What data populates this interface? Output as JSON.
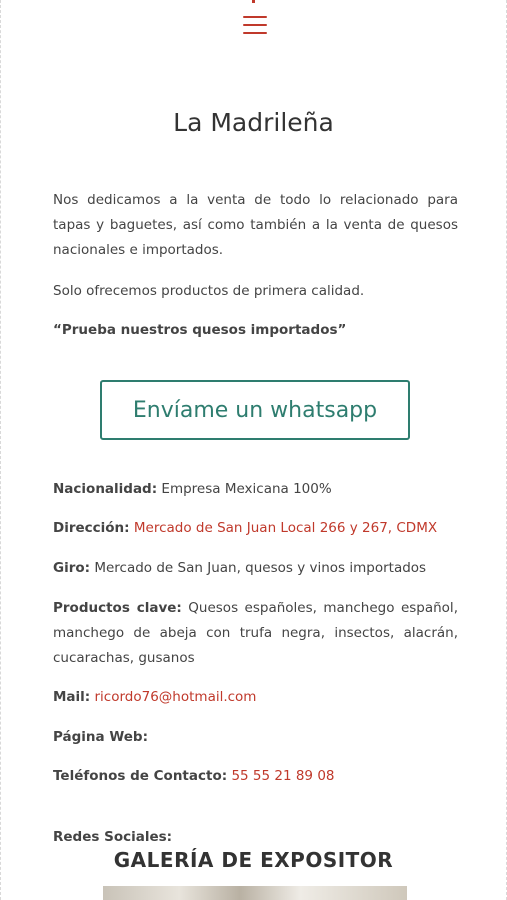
{
  "header": {
    "menu_icon": "hamburger-icon"
  },
  "main": {
    "title": "La Madrileña",
    "description": "Nos dedicamos a la venta de todo lo relacionado para tapas y baguetes, así como también a la venta de quesos nacionales e importados.",
    "quality": "Solo ofrecemos productos de primera calidad.",
    "slogan": "“Prueba nuestros quesos importados”",
    "whatsapp_button": "Envíame un whatsapp"
  },
  "details": {
    "nacionalidad_label": "Nacionalidad:",
    "nacionalidad_value": " Empresa Mexicana 100%",
    "direccion_label": "Dirección:",
    "direccion_value": "Mercado de San Juan Local 266 y 267, CDMX",
    "giro_label": "Giro:",
    "giro_value": " Mercado de San Juan, quesos y vinos importados",
    "productos_label": "Productos clave:",
    "productos_value": " Quesos españoles, manchego español, manchego de abeja con trufa negra, insectos, alacrán, cucarachas, gusanos",
    "mail_label": "Mail:",
    "mail_value": "ricordo76@hotmail.com",
    "web_label": "Página Web:",
    "telefonos_label": "Teléfonos de Contacto:",
    "telefonos_value": "55 55 21 89 08",
    "redes_label": "Redes Sociales:"
  },
  "gallery": {
    "title": "GALERÍA DE EXPOSITOR"
  },
  "colors": {
    "accent": "#c0392b",
    "whatsapp": "#2e7d6f",
    "text": "#444444"
  }
}
